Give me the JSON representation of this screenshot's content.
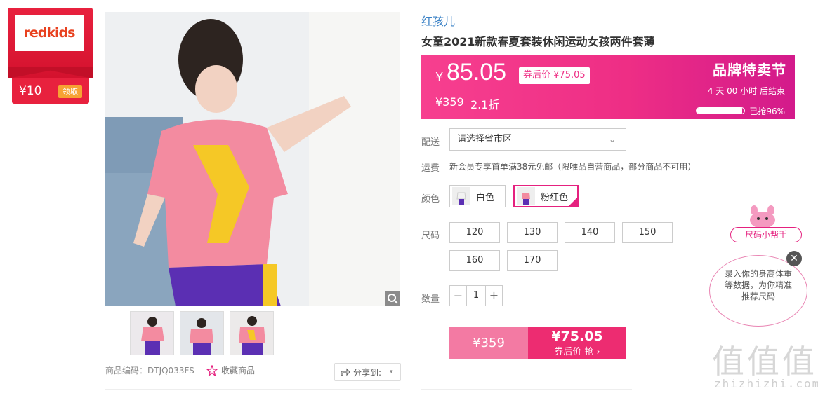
{
  "coupon": {
    "logo": "redkids",
    "value": "¥10",
    "claim_label": "领取"
  },
  "gallery": {
    "product_code": "商品编码：DTJQ033FS",
    "favorite_label": "收藏商品",
    "share_label": "分享到:"
  },
  "product": {
    "brand": "红孩儿",
    "title": "女童2021新款春夏套装休闲运动女孩两件套薄"
  },
  "price": {
    "currency": "¥",
    "current": "85.05",
    "coupon_label": "券后价",
    "coupon_price": "¥75.05",
    "original": "¥359",
    "discount": "2.1折"
  },
  "promo": {
    "title": "品牌特卖节",
    "countdown": "4  天  00  小时  后结束",
    "sold_progress": 0.96,
    "sold_text": "已抢96%"
  },
  "shipping": {
    "label": "配送",
    "select_value": "请选择省市区",
    "fee_label": "运费",
    "fee_text": "新会员专享首单满38元免邮（限唯品自营商品，部分商品不可用）"
  },
  "colors": {
    "label": "颜色",
    "options": [
      {
        "name": "白色",
        "selected": false
      },
      {
        "name": "粉红色",
        "selected": true
      }
    ]
  },
  "sizes": {
    "label": "尺码",
    "options": [
      "120",
      "130",
      "140",
      "150",
      "160",
      "170"
    ]
  },
  "quantity": {
    "label": "数量",
    "value": "1",
    "minus": "−",
    "plus": "+"
  },
  "buy": {
    "original": "¥359",
    "price": "¥75.05",
    "label": "券后价 抢 ›"
  },
  "helper": {
    "tag": "尺码小帮手",
    "message": "录入你的身高体重等数据，为你精准推荐尺码",
    "close": "✕"
  },
  "watermark": {
    "text": "值值值",
    "url": "zhizhizhi.com"
  },
  "colors_theme": {
    "accent": "#ee2e85",
    "link": "#3b82c6",
    "coupon_red": "#e8213e"
  }
}
